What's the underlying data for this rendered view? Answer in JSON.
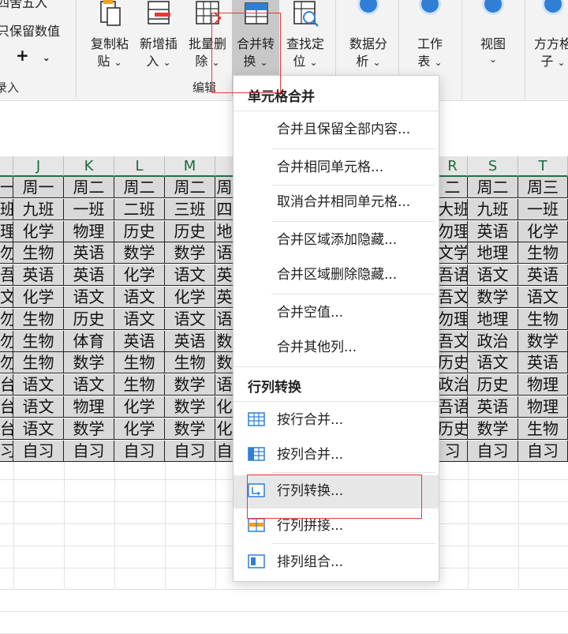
{
  "ribbon": {
    "left_partial": [
      "四舍五入",
      "只保留数值"
    ],
    "add_symbol": "+",
    "entry_label": "录入",
    "buttons": [
      {
        "l1": "复制粘",
        "l2": "贴"
      },
      {
        "l1": "新增插",
        "l2": "入"
      },
      {
        "l1": "批量删",
        "l2": "除"
      },
      {
        "l1": "合并转",
        "l2": "换"
      },
      {
        "l1": "查找定",
        "l2": "位"
      },
      {
        "l1": "数据分",
        "l2": "析"
      },
      {
        "l1": "工作",
        "l2": "表"
      },
      {
        "l1": "视图",
        "l2": ""
      },
      {
        "l1": "方方格",
        "l2": "子"
      }
    ],
    "group_edit": "编辑"
  },
  "columns": [
    "J",
    "K",
    "L",
    "M",
    "",
    "R",
    "S",
    "T"
  ],
  "left_rows": [
    [
      "周一",
      "周二",
      "周二",
      "周二",
      "周"
    ],
    [
      "九班",
      "一班",
      "二班",
      "三班",
      "四"
    ],
    [
      "化学",
      "物理",
      "历史",
      "历史",
      "地"
    ],
    [
      "生物",
      "英语",
      "数学",
      "数学",
      "语"
    ],
    [
      "英语",
      "英语",
      "化学",
      "语文",
      "英"
    ],
    [
      "化学",
      "语文",
      "语文",
      "化学",
      "英"
    ],
    [
      "生物",
      "历史",
      "语文",
      "语文",
      "语"
    ],
    [
      "生物",
      "体育",
      "英语",
      "英语",
      "数"
    ],
    [
      "生物",
      "数学",
      "生物",
      "生物",
      "数"
    ],
    [
      "语文",
      "语文",
      "生物",
      "数学",
      "语"
    ],
    [
      "语文",
      "物理",
      "化学",
      "数学",
      "化"
    ],
    [
      "语文",
      "数学",
      "化学",
      "数学",
      "化"
    ],
    [
      "自习",
      "自习",
      "自习",
      "自习",
      "自"
    ]
  ],
  "first_col_partial": [
    "一",
    "班",
    "理",
    "勿",
    "吾",
    "文",
    "勿",
    "勿",
    "勿",
    "台",
    "台",
    "台",
    "习"
  ],
  "right_rows": [
    [
      "二",
      "周二",
      "周三"
    ],
    [
      "大班",
      "九班",
      "一班"
    ],
    [
      "勿理",
      "英语",
      "化学"
    ],
    [
      "文学",
      "地理",
      "生物"
    ],
    [
      "吾语",
      "语文",
      "英语"
    ],
    [
      "吾文",
      "数学",
      "语文"
    ],
    [
      "勿理",
      "地理",
      "生物"
    ],
    [
      "吾文",
      "政治",
      "数学"
    ],
    [
      "历史",
      "语文",
      "英语"
    ],
    [
      "政治",
      "历史",
      "物理"
    ],
    [
      "吾语",
      "英语",
      "物理"
    ],
    [
      "历史",
      "数学",
      "生物"
    ],
    [
      "习",
      "自习",
      "自习"
    ]
  ],
  "menu": {
    "section1": "单元格合并",
    "items1": [
      "合并且保留全部内容...",
      "合并相同单元格...",
      "取消合并相同单元格...",
      "合并区域添加隐藏...",
      "合并区域删除隐藏...",
      "合并空值...",
      "合并其他列..."
    ],
    "section2": "行列转换",
    "items2": [
      "按行合并...",
      "按列合并...",
      "行列转换...",
      "行列拼接...",
      "排列组合..."
    ]
  }
}
